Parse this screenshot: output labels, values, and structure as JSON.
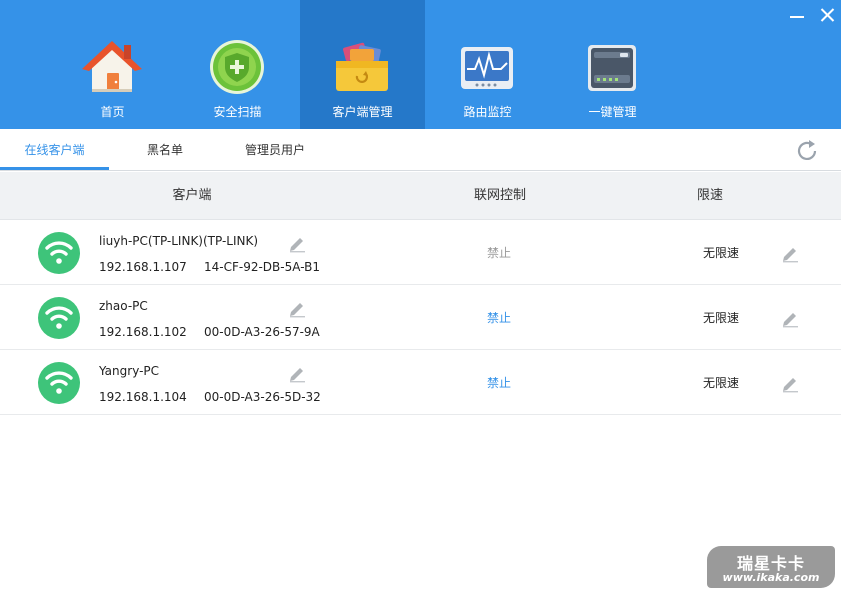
{
  "window": {
    "minimize_label": "",
    "close_label": ""
  },
  "nav": {
    "items": [
      {
        "label": "首页",
        "icon": "home-icon"
      },
      {
        "label": "安全扫描",
        "icon": "shield-plus-icon"
      },
      {
        "label": "客户端管理",
        "icon": "client-box-icon",
        "active": true
      },
      {
        "label": "路由监控",
        "icon": "monitor-chart-icon"
      },
      {
        "label": "一键管理",
        "icon": "router-device-icon"
      }
    ]
  },
  "tabs": {
    "items": [
      {
        "label": "在线客户端",
        "active": true
      },
      {
        "label": "黑名单"
      },
      {
        "label": "管理员用户"
      }
    ]
  },
  "table": {
    "headers": {
      "client": "客户端",
      "network": "联网控制",
      "speed": "限速"
    },
    "rows": [
      {
        "name": "liuyh-PC(TP-LINK)(TP-LINK)",
        "ip": "192.168.1.107",
        "mac": "14-CF-92-DB-5A-B1",
        "control": "禁止",
        "control_state": "disabled",
        "speed": "无限速"
      },
      {
        "name": "zhao-PC",
        "ip": "192.168.1.102",
        "mac": "00-0D-A3-26-57-9A",
        "control": "禁止",
        "control_state": "link",
        "speed": "无限速"
      },
      {
        "name": "Yangry-PC",
        "ip": "192.168.1.104",
        "mac": "00-0D-A3-26-5D-32",
        "control": "禁止",
        "control_state": "link",
        "speed": "无限速"
      }
    ]
  },
  "watermark": {
    "title": "瑞星卡卡",
    "url": "www.ikaka.com"
  },
  "colors": {
    "header_blue": "#3592e8",
    "active_nav": "#2578c9",
    "wifi_green": "#3ec47a",
    "link_blue": "#3592e8"
  }
}
